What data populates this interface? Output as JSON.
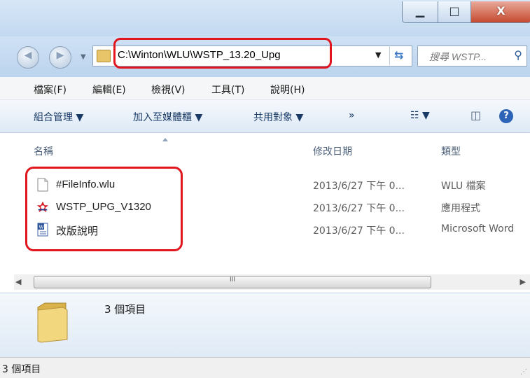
{
  "titlebar": {
    "minimize_glyph": "▁",
    "maximize_glyph": "□",
    "close_glyph": "X"
  },
  "address": {
    "path": "C:\\Winton\\WLU\\WSTP_13.20_Upg",
    "search_placeholder": "搜尋 WSTP...",
    "highlight_color": "#e0151e"
  },
  "menu": {
    "items": [
      "檔案(F)",
      "編輯(E)",
      "檢視(V)",
      "工具(T)",
      "說明(H)"
    ]
  },
  "toolbar": {
    "organize": "組合管理 ▼",
    "add_to_library": "加入至媒體櫃 ▼",
    "share_with": "共用對象 ▼",
    "more": "»",
    "views": "☷ ▼",
    "help": "?"
  },
  "columns": {
    "name": "名稱",
    "date": "修改日期",
    "type": "類型"
  },
  "files": [
    {
      "name": "#FileInfo.wlu",
      "date": "2013/6/27 下午 0...",
      "type": "WLU 檔案",
      "icon": "blank-file-icon"
    },
    {
      "name": "WSTP_UPG_V1320",
      "date": "2013/6/27 下午 0...",
      "type": "應用程式",
      "icon": "app-icon"
    },
    {
      "name": "改版說明",
      "date": "2013/6/27 下午 0...",
      "type": "Microsoft Word",
      "icon": "word-doc-icon"
    }
  ],
  "scrollbar": {
    "grip": "III"
  },
  "details": {
    "count": "3 個項目"
  },
  "status": {
    "text": "3 個項目"
  }
}
